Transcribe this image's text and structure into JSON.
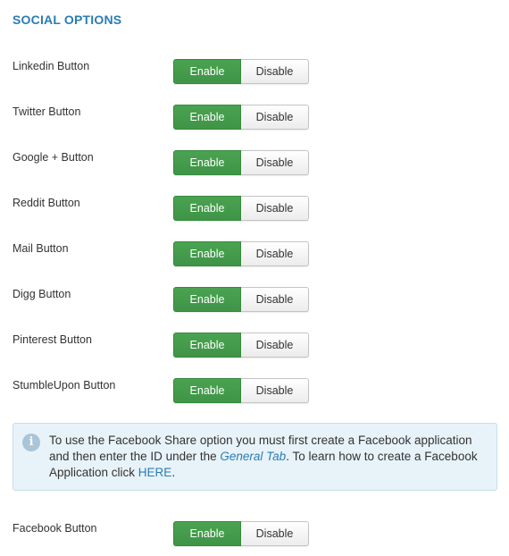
{
  "section": {
    "title": "SOCIAL OPTIONS"
  },
  "options": [
    {
      "label": "Linkedin Button",
      "enable": "Enable",
      "disable": "Disable",
      "selected": "Enable"
    },
    {
      "label": "Twitter Button",
      "enable": "Enable",
      "disable": "Disable",
      "selected": "Enable"
    },
    {
      "label": "Google + Button",
      "enable": "Enable",
      "disable": "Disable",
      "selected": "Enable"
    },
    {
      "label": "Reddit Button",
      "enable": "Enable",
      "disable": "Disable",
      "selected": "Enable"
    },
    {
      "label": "Mail Button",
      "enable": "Enable",
      "disable": "Disable",
      "selected": "Enable"
    },
    {
      "label": "Digg Button",
      "enable": "Enable",
      "disable": "Disable",
      "selected": "Enable"
    },
    {
      "label": "Pinterest Button",
      "enable": "Enable",
      "disable": "Disable",
      "selected": "Enable"
    },
    {
      "label": "StumbleUpon Button",
      "enable": "Enable",
      "disable": "Disable",
      "selected": "Enable"
    }
  ],
  "info": {
    "icon": "info-icon",
    "text_before": "To use the Facebook Share option you must first create a Facebook application and then enter the ID under the ",
    "link_general_tab": "General Tab",
    "text_middle": ". To learn how to create a Facebook Application click ",
    "link_here": "HERE",
    "text_after": "."
  },
  "facebook": {
    "label": "Facebook Button",
    "enable": "Enable",
    "disable": "Disable",
    "selected": "Enable"
  },
  "colors": {
    "accent": "#2a7cb4",
    "enable_green": "#43994a",
    "info_bg": "#e8f3f9"
  }
}
